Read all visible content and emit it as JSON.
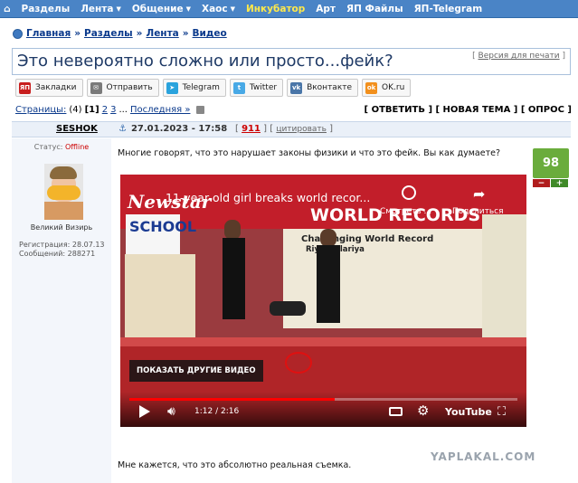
{
  "nav": {
    "items": [
      {
        "label": "Разделы",
        "caret": false,
        "highlight": false
      },
      {
        "label": "Лента",
        "caret": true,
        "highlight": false
      },
      {
        "label": "Общение",
        "caret": true,
        "highlight": false
      },
      {
        "label": "Хаос",
        "caret": true,
        "highlight": false
      },
      {
        "label": "Инкубатор",
        "caret": false,
        "highlight": true
      },
      {
        "label": "Арт",
        "caret": false,
        "highlight": false
      },
      {
        "label": "ЯП Файлы",
        "caret": false,
        "highlight": false
      },
      {
        "label": "ЯП-Telegram",
        "caret": false,
        "highlight": false
      }
    ]
  },
  "breadcrumb": [
    "Главная",
    "Разделы",
    "Лента",
    "Видео"
  ],
  "topic": {
    "title": "Это невероятно сложно или просто...фейк?",
    "print_label": "Версия для печати"
  },
  "share": [
    {
      "label": "Закладки",
      "icon": "yap-icon",
      "icon_text": "ЯП",
      "color": "#c81e1e"
    },
    {
      "label": "Отправить",
      "icon": "mail-icon",
      "icon_text": "✉",
      "color": "#7a7a7a"
    },
    {
      "label": "Telegram",
      "icon": "telegram-icon",
      "icon_text": "➤",
      "color": "#2aa3dd"
    },
    {
      "label": "Twitter",
      "icon": "twitter-icon",
      "icon_text": "t",
      "color": "#48a9e6"
    },
    {
      "label": "Вконтакте",
      "icon": "vk-icon",
      "icon_text": "vk",
      "color": "#4a76a8"
    },
    {
      "label": "OK.ru",
      "icon": "ok-icon",
      "icon_text": "ok",
      "color": "#f2901d"
    }
  ],
  "pager": {
    "label": "Страницы:",
    "count": "(4)",
    "current": "[1]",
    "pages": [
      "2",
      "3"
    ],
    "ellipsis": "...",
    "last": "Последняя »"
  },
  "actions": "[ ОТВЕТИТЬ ] [ НОВАЯ ТЕМА ] [ ОПРОС ]",
  "post": {
    "author": "SESHOK",
    "date": "27.01.2023 - 17:58",
    "number_open": "[ ",
    "number": "911",
    "number_close": " ]",
    "quote": "цитировать",
    "status_label": "Статус:",
    "status": "Offline",
    "rank": "Великий Визирь",
    "registration": "Регистрация: 28.07.13",
    "messages": "Сообщений: 288271",
    "text1": "Многие говорят, что это нарушает законы физики и что это фейк. Вы как думаете?",
    "text2": "Мне кажется, что это абсолютно реальная съемка.",
    "rating": "98",
    "minus": "−",
    "plus": "+"
  },
  "video": {
    "channel": "Newstar",
    "title": "11-year-old girl breaks world recor...",
    "watch_later": "Смотреть ...",
    "share": "Поделиться",
    "more_videos": "ПОКАЗАТЬ ДРУГИЕ ВИДЕО",
    "time": "1:12 / 2:16",
    "progress": 0.53,
    "brand": "YouTube",
    "banner_text": "WORLD RECORDS",
    "banner_sub": "Challenging World Record",
    "school": "SCHOOL",
    "stage_sub": "Riya Malariya"
  },
  "watermark": "YAPLAKAL.COM"
}
